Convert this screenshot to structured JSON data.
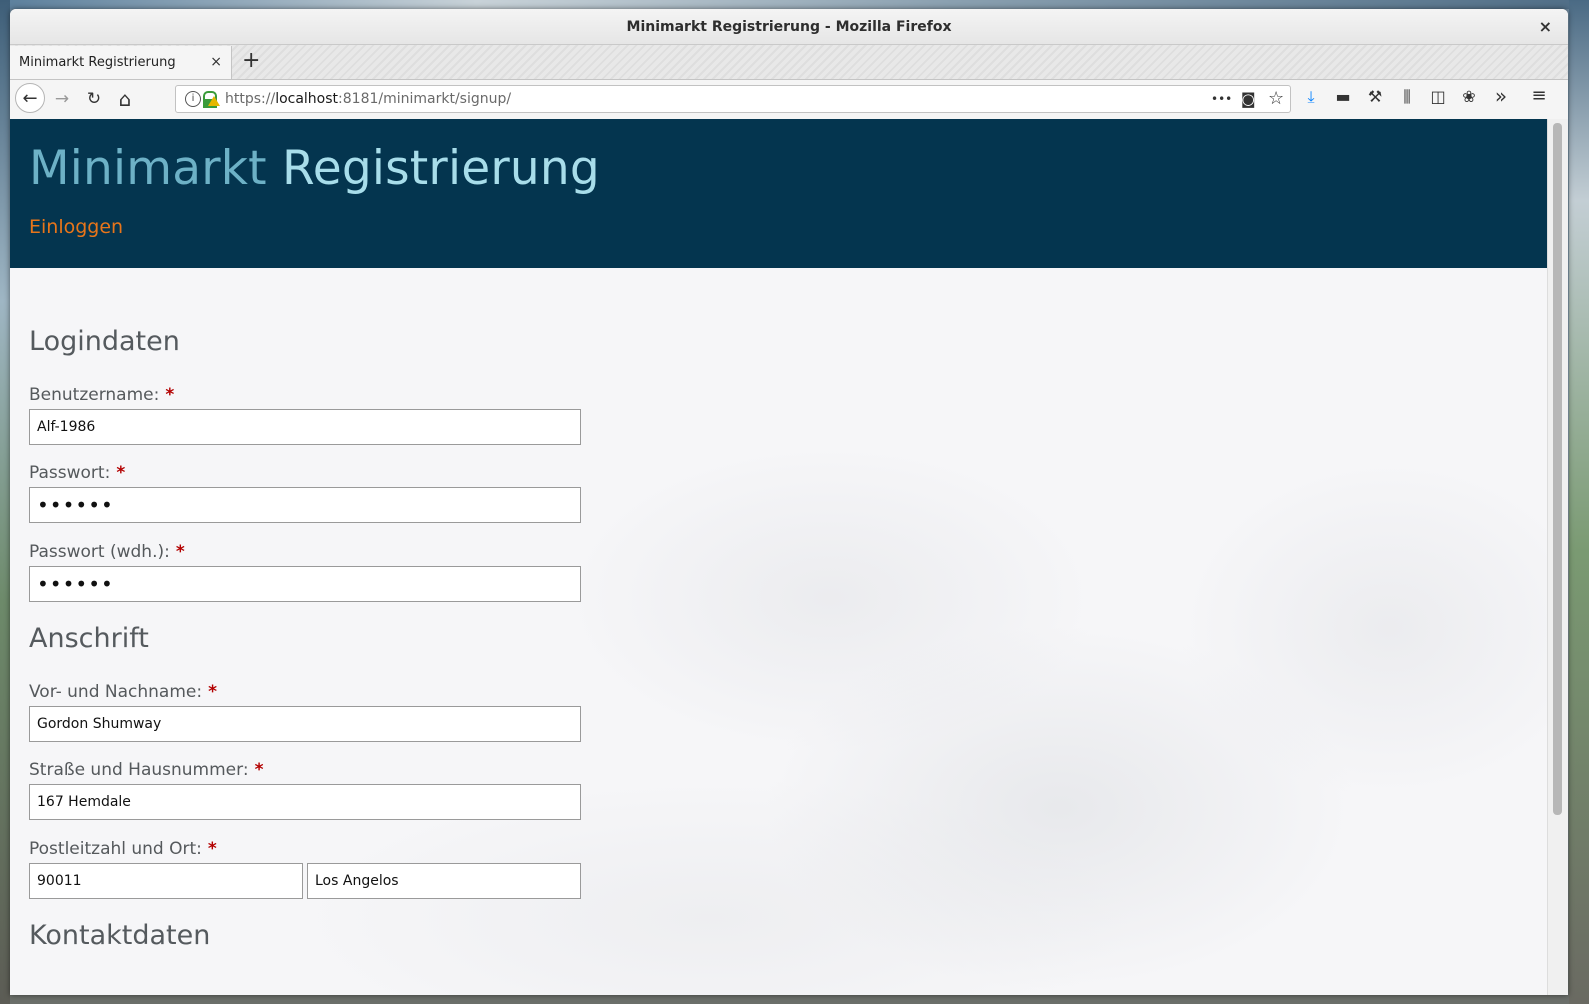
{
  "window": {
    "title": "Minimarkt Registrierung - Mozilla Firefox",
    "close_glyph": "×"
  },
  "tabs": [
    {
      "label": "Minimarkt Registrierung",
      "close_glyph": "×"
    }
  ],
  "new_tab_glyph": "+",
  "nav": {
    "back_glyph": "←",
    "forward_glyph": "→",
    "reload_glyph": "↻",
    "home_glyph": "⌂",
    "url_prefix": "https://",
    "url_host": "localhost",
    "url_rest": ":8181/minimarkt/signup/",
    "page_actions_glyph": "•••",
    "pocket_glyph": "◙",
    "bookmark_glyph": "☆",
    "download_glyph": "⤓",
    "screenshot_glyph": "▬",
    "tools_glyph": "⚒",
    "library_glyph": "⫼",
    "sidebar_glyph": "◫",
    "extension_glyph": "❀",
    "overflow_glyph": "»",
    "menu_glyph": "≡"
  },
  "site": {
    "title_part1": "Minimarkt",
    "title_part2": "Registrierung",
    "login_link": "Einloggen"
  },
  "form": {
    "required_mark": "*",
    "section_login": "Logindaten",
    "username_label": "Benutzername:",
    "username_value": "Alf-1986",
    "password_label": "Passwort:",
    "password_value": "••••••",
    "password_repeat_label": "Passwort (wdh.):",
    "password_repeat_value": "••••••",
    "section_address": "Anschrift",
    "name_label": "Vor- und Nachname:",
    "name_value": "Gordon Shumway",
    "street_label": "Straße und Hausnummer:",
    "street_value": "167 Hemdale",
    "zip_city_label": "Postleitzahl und Ort:",
    "zip_value": "90011",
    "city_value": "Los Angelos",
    "section_contact": "Kontaktdaten"
  },
  "colors": {
    "header_bg": "#04354f",
    "title_part1": "#6db1c6",
    "title_part2": "#a8ddea",
    "login_link": "#e8751a",
    "required": "#b30000"
  }
}
